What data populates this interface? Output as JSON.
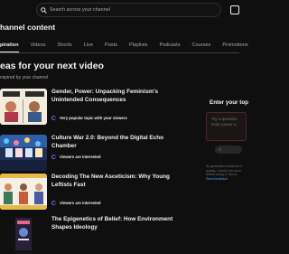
{
  "search": {
    "placeholder": "Search across your channel"
  },
  "page": {
    "title": "hannel content"
  },
  "tabs": [
    {
      "label": "piration",
      "active": true
    },
    {
      "label": "Videos"
    },
    {
      "label": "Shorts"
    },
    {
      "label": "Live"
    },
    {
      "label": "Posts"
    },
    {
      "label": "Playlists"
    },
    {
      "label": "Podcasts"
    },
    {
      "label": "Courses"
    },
    {
      "label": "Promotions"
    }
  ],
  "section": {
    "title": "eas for your next video",
    "subtitle": "nspired by your channel"
  },
  "ideas": [
    {
      "title": "Gender, Power: Unpacking Feminism's Unintended Consequences",
      "badge": "Very popular topic with your viewers"
    },
    {
      "title": "Culture War 2.0: Beyond the Digital Echo Chamber",
      "badge": "Viewers are interested"
    },
    {
      "title": "Decoding The New Asceticism: Why Young Leftists Fast",
      "badge": "Viewers are interested"
    },
    {
      "title": "The Epigenetics of Belief: How Environment Shapes Ideology",
      "badge": ""
    }
  ],
  "side_panel": {
    "title": "Enter your top",
    "input_placeholder_line1": "Try a question",
    "input_placeholder_line2": "solar power a",
    "button_label": "S",
    "note_line1": "AI-generated content is e",
    "note_line2": "quality. Check it for accu",
    "note_line3": "before using it. Terms",
    "feedback_link": "Send feedback"
  },
  "colors": {
    "background": "#0f0f0f",
    "accent": "#8b5cf6",
    "link": "#3ea6ff"
  }
}
